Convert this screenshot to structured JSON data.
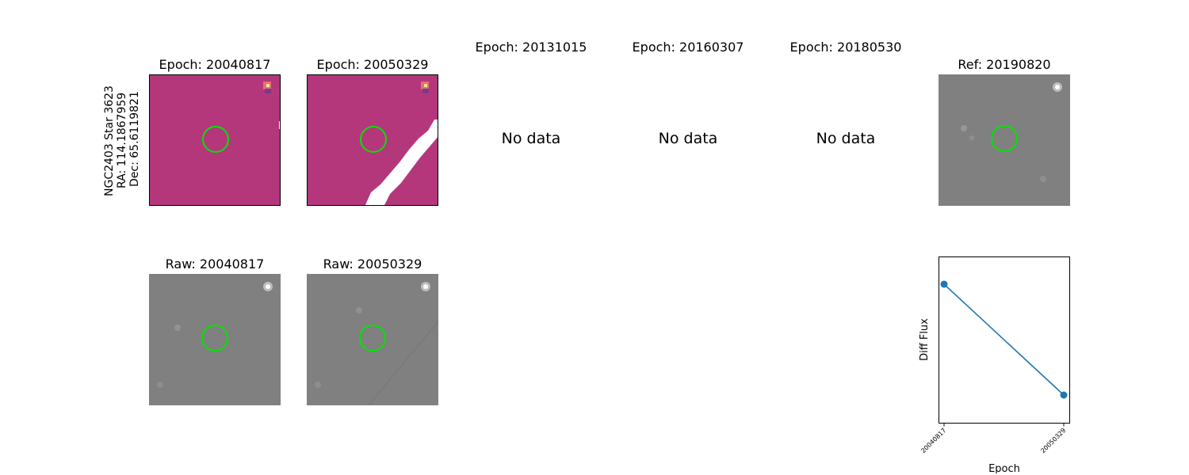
{
  "side_label": [
    "NGC2403 Star 3623",
    "RA: 114.1867959",
    "Dec: 65.6119821"
  ],
  "top_titles": {
    "e1": "Epoch: 20040817",
    "e2": "Epoch: 20050329",
    "e3": "Epoch: 20131015",
    "e4": "Epoch: 20160307",
    "e5": "Epoch: 20180530",
    "ref": "Ref: 20190820"
  },
  "no_data_text": "No data",
  "raw_titles": {
    "r1": "Raw: 20040817",
    "r2": "Raw: 20050329"
  },
  "colors": {
    "diff_bg": "#b4377c",
    "raw_bg": "#808080",
    "aperture": "#00e400",
    "series": "#1f77b4"
  },
  "chart_data": {
    "type": "line",
    "x": [
      "20040817",
      "20050329"
    ],
    "series": [
      {
        "values": [
          1.0,
          0.0
        ]
      }
    ],
    "xlabel": "Epoch",
    "ylabel": "Diff Flux",
    "yticks": "none",
    "grid": false
  }
}
